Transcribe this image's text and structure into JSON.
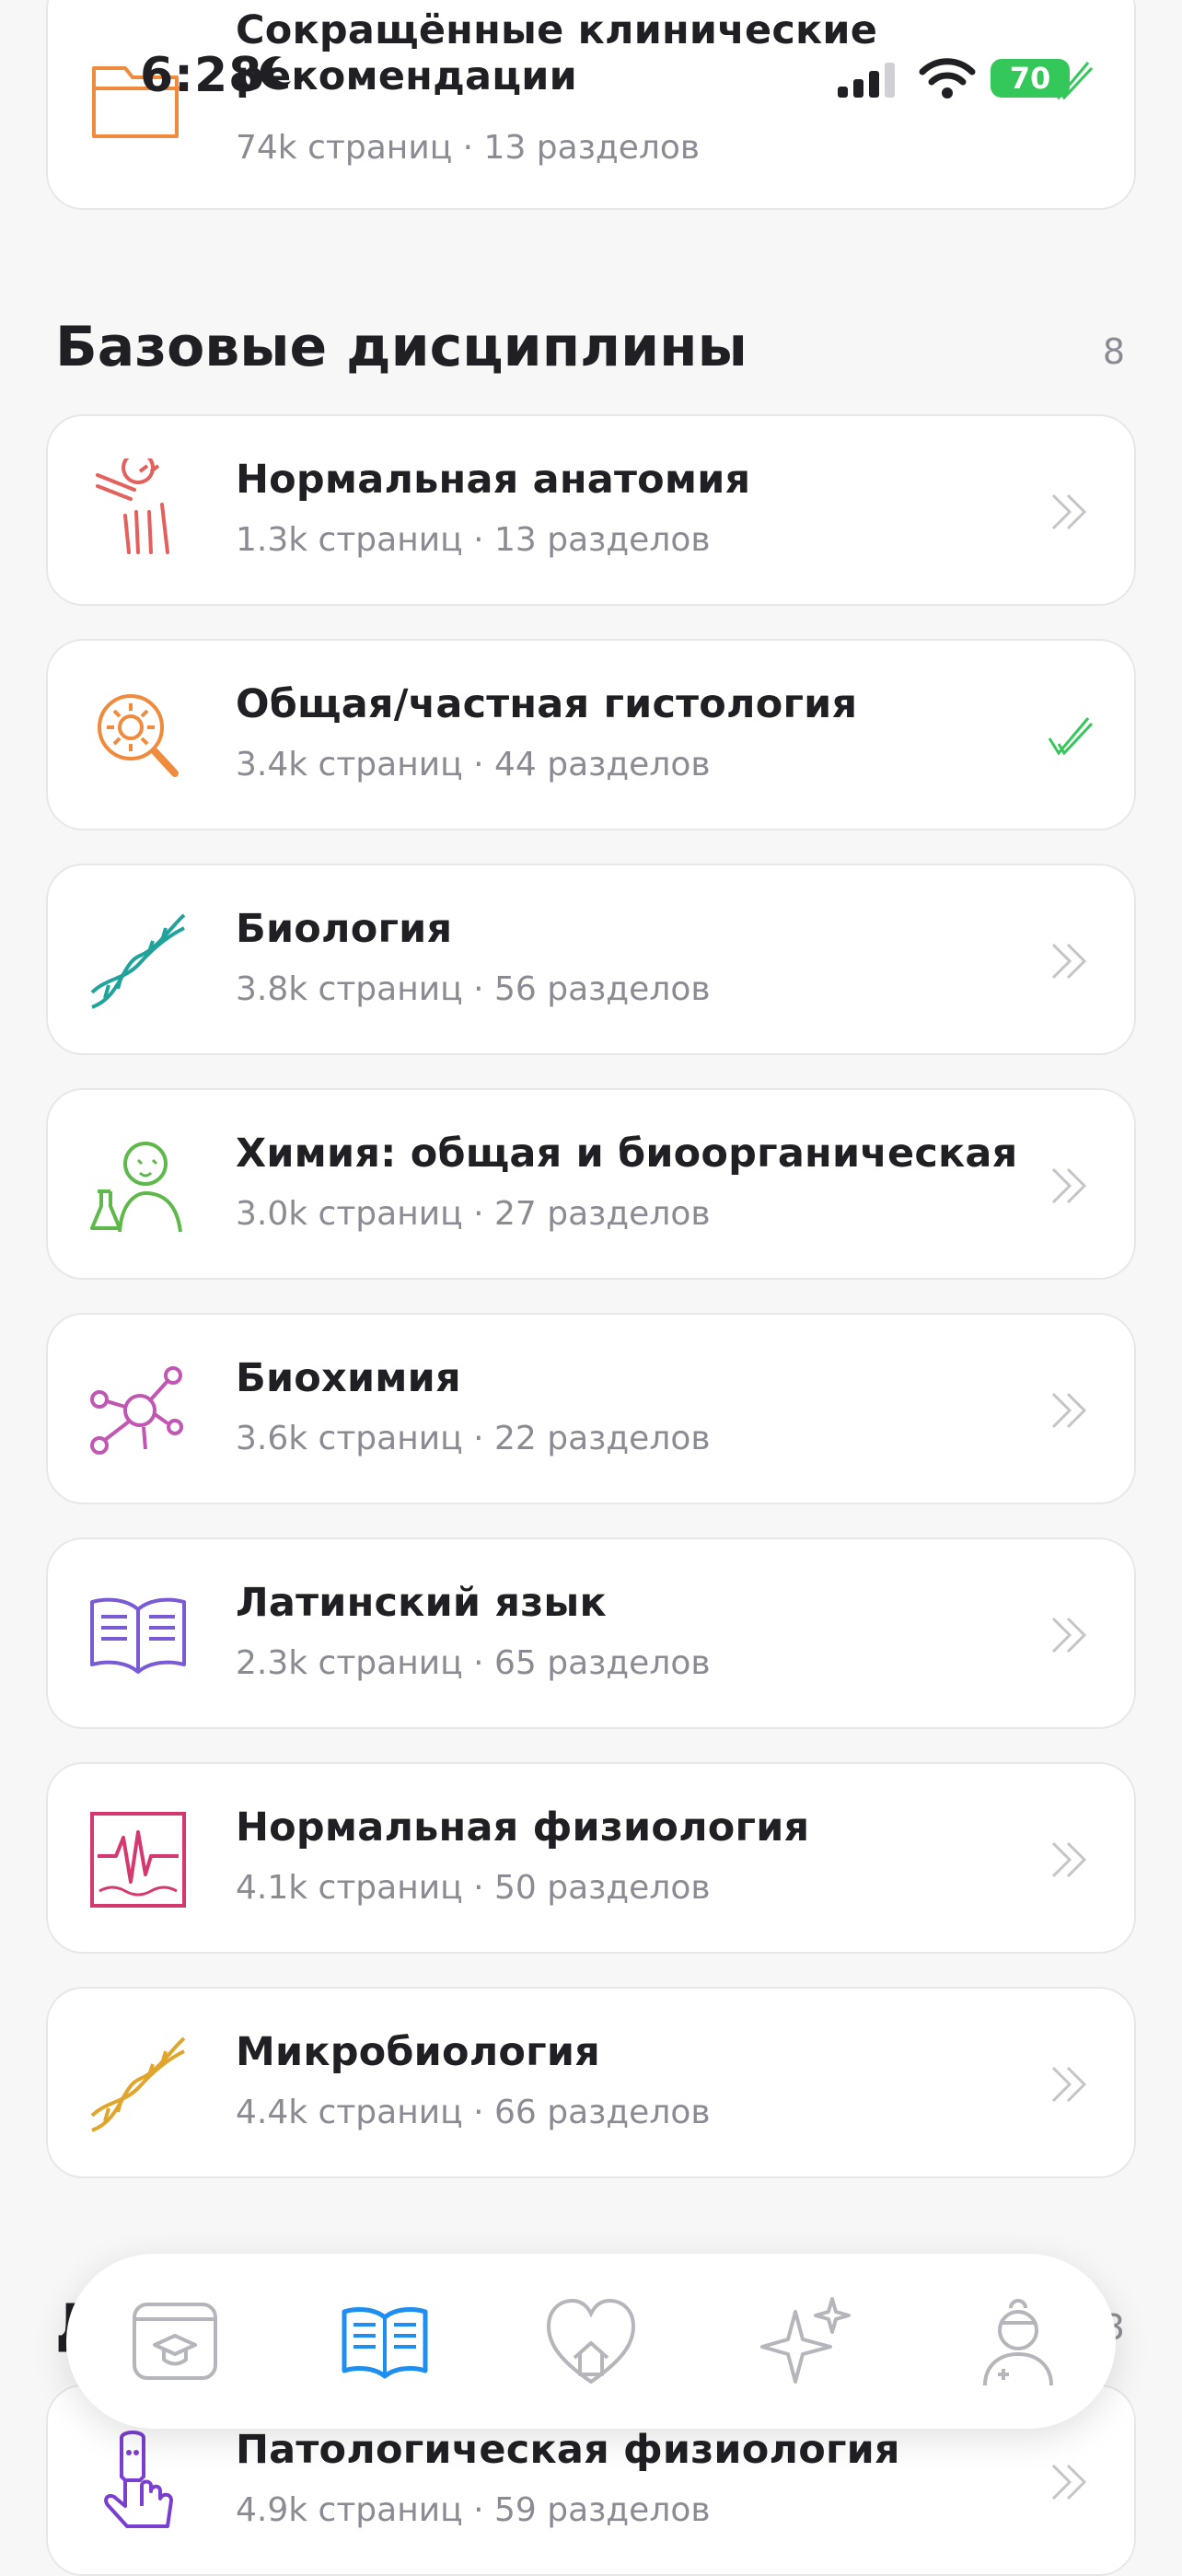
{
  "status_bar": {
    "time": "6:28",
    "battery": "70"
  },
  "top_card": {
    "title_line1": "Сокращённые клинические",
    "title_line2": "рекомендации",
    "meta": "74k страниц · 13 разделов"
  },
  "section_basic": {
    "title": "Базовые дисциплины",
    "count": "8"
  },
  "items": [
    {
      "title": "Нормальная анатомия",
      "meta": "1.3k страниц · 13 разделов",
      "icon": "anatomy-joint-icon",
      "status": "chevron"
    },
    {
      "title": "Общая/частная гистология",
      "meta": "3.4k страниц · 44 разделов",
      "icon": "microscope-cell-icon",
      "status": "check"
    },
    {
      "title": "Биология",
      "meta": "3.8k страниц · 56 разделов",
      "icon": "dna-icon",
      "status": "chevron"
    },
    {
      "title": "Химия: общая и биоорганическая",
      "meta": "3.0k страниц · 27 разделов",
      "icon": "chemist-flask-icon",
      "status": "chevron"
    },
    {
      "title": "Биохимия",
      "meta": "3.6k страниц · 22 разделов",
      "icon": "molecule-icon",
      "status": "chevron"
    },
    {
      "title": "Латинский язык",
      "meta": "2.3k страниц · 65 разделов",
      "icon": "open-book-icon",
      "status": "chevron"
    },
    {
      "title": "Нормальная физиология",
      "meta": "4.1k страниц · 50 разделов",
      "icon": "ecg-monitor-icon",
      "status": "chevron"
    },
    {
      "title": "Микробиология",
      "meta": "4.4k страниц · 66 разделов",
      "icon": "dna-yellow-icon",
      "status": "chevron"
    }
  ],
  "section_next": {
    "title_partial": "Д",
    "count_partial": "3"
  },
  "bottom_item": {
    "title": "Патологическая физиология",
    "meta": "4.9k страниц · 59 разделов",
    "icon": "finger-virus-icon"
  },
  "tabs": [
    {
      "name": "courses-tab",
      "icon": "graduation-cap-window-icon",
      "active": false
    },
    {
      "name": "library-tab",
      "icon": "open-book-icon",
      "active": true
    },
    {
      "name": "home-tab",
      "icon": "heart-house-icon",
      "active": false
    },
    {
      "name": "ai-tab",
      "icon": "sparkles-icon",
      "active": false
    },
    {
      "name": "profile-tab",
      "icon": "doctor-avatar-icon",
      "active": false
    }
  ],
  "colors": {
    "accent": "#1f8ef1",
    "check": "#34c759",
    "battery": "#34c759"
  }
}
